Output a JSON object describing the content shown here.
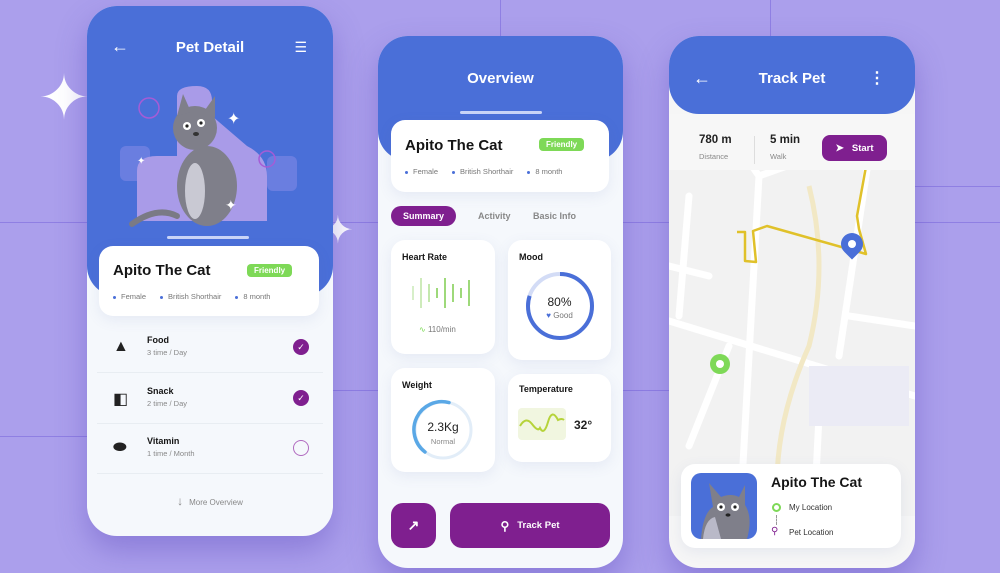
{
  "pet_detail": {
    "title": "Pet Detail",
    "back_icon": "arrow-left-icon",
    "filter_icon": "sliders-icon",
    "pet": {
      "name": "Apito The Cat",
      "badge": "Friendly",
      "gender": "Female",
      "breed": "British Shorthair",
      "age": "8 month"
    },
    "items": [
      {
        "label": "Food",
        "sub": "3 time / Day",
        "icon": "food-bowl-icon",
        "checked": true
      },
      {
        "label": "Snack",
        "sub": "2 time / Day",
        "icon": "snack-bag-icon",
        "checked": true
      },
      {
        "label": "Vitamin",
        "sub": "1 time / Month",
        "icon": "pill-icon",
        "checked": false
      }
    ],
    "more": "More Overview"
  },
  "overview": {
    "title": "Overview",
    "pet": {
      "name": "Apito The Cat",
      "badge": "Friendly",
      "gender": "Female",
      "breed": "British Shorthair",
      "age": "8 month"
    },
    "tabs": [
      "Summary",
      "Activity",
      "Basic Info"
    ],
    "active_tab": "Summary",
    "heart_rate": {
      "label": "Heart Rate",
      "value": "110/min"
    },
    "mood": {
      "label": "Mood",
      "value": "80%",
      "status": "Good",
      "percent": 80
    },
    "weight": {
      "label": "Weight",
      "value": "2.3Kg",
      "status": "Normal"
    },
    "temperature": {
      "label": "Temperature",
      "value": "32°"
    },
    "track_button": "Track Pet"
  },
  "track_pet": {
    "title": "Track Pet",
    "distance": {
      "value": "780 m",
      "label": "Distance"
    },
    "walk": {
      "value": "5 min",
      "label": "Walk"
    },
    "start_button": "Start",
    "pet_name": "Apito The Cat",
    "my_location": "My Location",
    "pet_location": "Pet Location"
  },
  "colors": {
    "primary": "#4a6fd8",
    "accent": "#7f1f8f",
    "green": "#7ed957",
    "route": "#e0c12a"
  }
}
